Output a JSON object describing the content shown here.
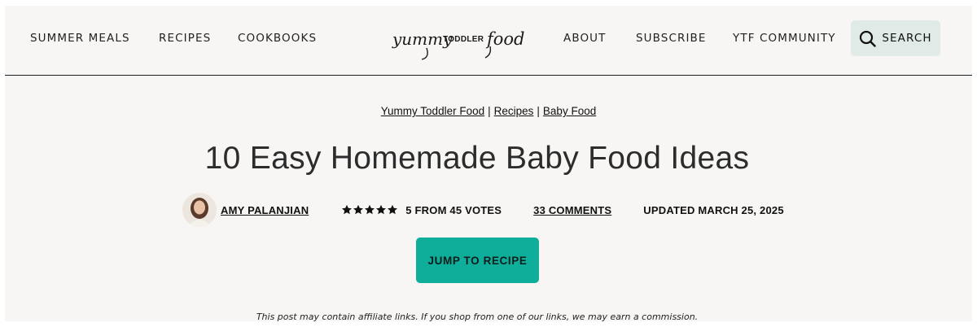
{
  "nav": {
    "left": [
      "SUMMER MEALS",
      "RECIPES",
      "COOKBOOKS"
    ],
    "right": [
      "ABOUT",
      "SUBSCRIBE",
      "YTF COMMUNITY"
    ],
    "search_label": "SEARCH",
    "search_icon": "search-icon"
  },
  "logo": {
    "part1": "yummy",
    "part2": "TODDLER",
    "part3": "food"
  },
  "breadcrumb": {
    "items": [
      "Yummy Toddler Food",
      "Recipes",
      "Baby Food"
    ],
    "separator": "|"
  },
  "article": {
    "title": "10 Easy Homemade Baby Food Ideas",
    "author": "AMY PALANJIAN",
    "rating_text": "5 FROM 45 VOTES",
    "rating_value": 5,
    "comments": "33 COMMENTS",
    "updated": "UPDATED MARCH 25, 2025",
    "jump_label": "JUMP TO RECIPE",
    "disclaimer": "This post may contain affiliate links. If you shop from one of our links, we may earn a commission."
  },
  "colors": {
    "background": "#f7f6f4",
    "accent": "#0fae9a",
    "search_bg": "#e0ebe8"
  }
}
